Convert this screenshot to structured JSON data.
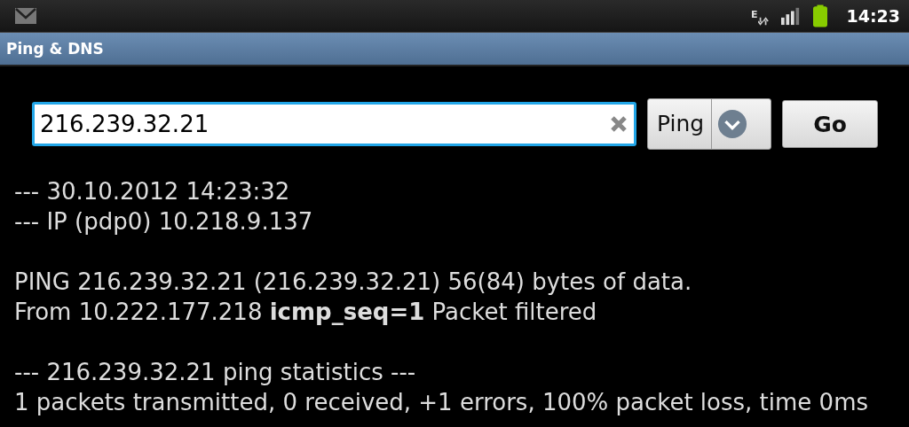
{
  "status_bar": {
    "network_type": "E",
    "time": "14:23"
  },
  "window": {
    "title": "Ping & DNS"
  },
  "query": {
    "value": "216.239.32.21",
    "focused": true
  },
  "mode_spinner": {
    "value": "Ping"
  },
  "go_button": {
    "label": "Go"
  },
  "output": [
    [
      "--- 30.10.2012 14:23:32",
      "--- IP (pdp0) 10.218.9.137"
    ],
    [
      "PING 216.239.32.21 (216.239.32.21) 56(84) bytes of data.",
      "From 10.222.177.218 **icmp_seq=1** Packet filtered"
    ],
    [
      "--- 216.239.32.21 ping statistics ---",
      "1 packets transmitted, 0 received, +1 errors, 100% packet loss, time 0ms"
    ]
  ]
}
